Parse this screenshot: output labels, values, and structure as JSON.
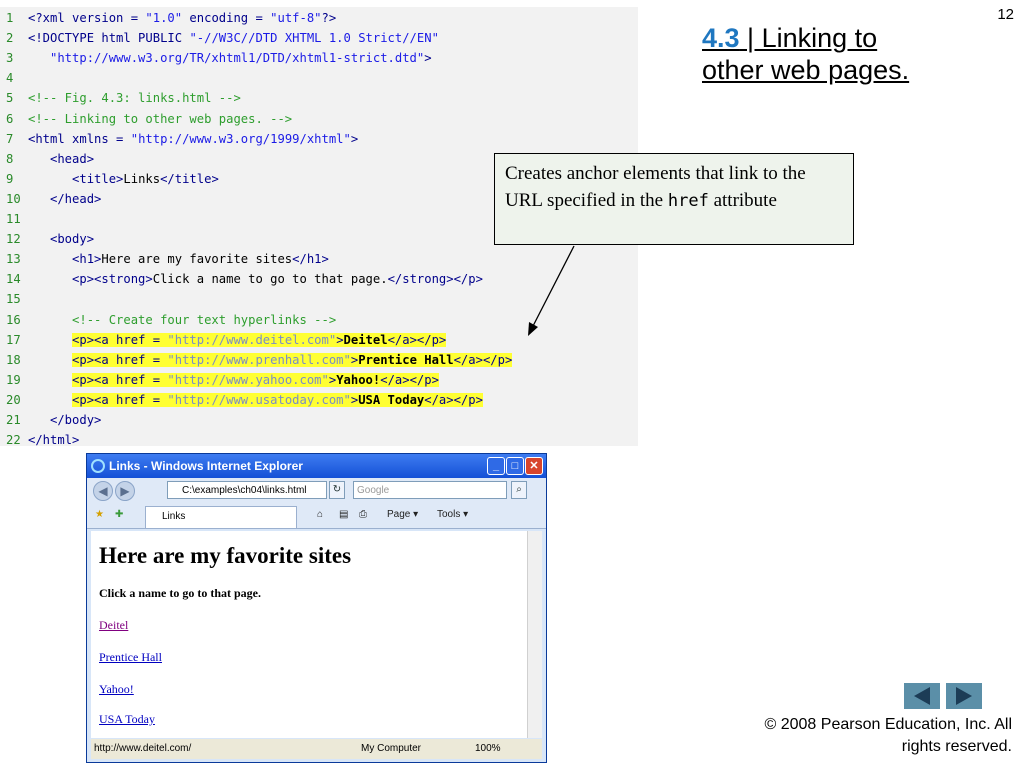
{
  "slide": {
    "number": "12",
    "title_num": "4.3",
    "title_rest": " | Linking to other web pages.",
    "callout_pre": "Creates anchor elements that link to the URL specified in the ",
    "callout_code": "href",
    "callout_post": " attribute",
    "copyright": "© 2008 Pearson Education, Inc.  All rights reserved."
  },
  "code": [
    {
      "n": "1",
      "parts": [
        [
          "tag",
          "<?xml version = "
        ],
        [
          "str",
          "\"1.0\""
        ],
        [
          "tag",
          " encoding = "
        ],
        [
          "str",
          "\"utf-8\""
        ],
        [
          "tag",
          "?>"
        ]
      ]
    },
    {
      "n": "2",
      "parts": [
        [
          "tag",
          "<!DOCTYPE html PUBLIC "
        ],
        [
          "str",
          "\"-//W3C//DTD XHTML 1.0 Strict//EN\""
        ]
      ]
    },
    {
      "n": "3",
      "parts": [
        [
          "str",
          "   \"http://www.w3.org/TR/xhtml1/DTD/xhtml1-strict.dtd\""
        ],
        [
          "tag",
          ">"
        ]
      ]
    },
    {
      "n": "4",
      "parts": []
    },
    {
      "n": "5",
      "parts": [
        [
          "com",
          "<!-- Fig. 4.3: links.html -->"
        ]
      ]
    },
    {
      "n": "6",
      "parts": [
        [
          "com",
          "<!-- Linking to other web pages. -->"
        ]
      ]
    },
    {
      "n": "7",
      "parts": [
        [
          "tag",
          "<html xmlns = "
        ],
        [
          "str",
          "\"http://www.w3.org/1999/xhtml\""
        ],
        [
          "tag",
          ">"
        ]
      ]
    },
    {
      "n": "8",
      "parts": [
        [
          "tag",
          "   <head>"
        ]
      ]
    },
    {
      "n": "9",
      "parts": [
        [
          "tag",
          "      <title>"
        ],
        [
          "txt",
          "Links"
        ],
        [
          "tag",
          "</title>"
        ]
      ]
    },
    {
      "n": "10",
      "parts": [
        [
          "tag",
          "   </head>"
        ]
      ]
    },
    {
      "n": "11",
      "parts": []
    },
    {
      "n": "12",
      "parts": [
        [
          "tag",
          "   <body>"
        ]
      ]
    },
    {
      "n": "13",
      "parts": [
        [
          "tag",
          "      <h1>"
        ],
        [
          "txt",
          "Here are my favorite sites"
        ],
        [
          "tag",
          "</h1>"
        ]
      ]
    },
    {
      "n": "14",
      "parts": [
        [
          "tag",
          "      <p><strong>"
        ],
        [
          "txt",
          "Click a name to go to that page."
        ],
        [
          "tag",
          "</strong></p>"
        ]
      ]
    },
    {
      "n": "15",
      "parts": []
    },
    {
      "n": "16",
      "parts": [
        [
          "com",
          "      <!-- Create four text hyperlinks -->"
        ]
      ]
    },
    {
      "n": "17",
      "hl": true,
      "parts": [
        [
          "tag",
          "<p><a href = "
        ],
        [
          "str",
          "\"http://www.deitel.com\""
        ],
        [
          "tag",
          ">"
        ],
        [
          "b",
          "Deitel"
        ],
        [
          "tag",
          "</a></p>"
        ]
      ]
    },
    {
      "n": "18",
      "hl": true,
      "parts": [
        [
          "tag",
          "<p><a href = "
        ],
        [
          "str",
          "\"http://www.prenhall.com\""
        ],
        [
          "tag",
          ">"
        ],
        [
          "b",
          "Prentice Hall"
        ],
        [
          "tag",
          "</a></p>"
        ]
      ]
    },
    {
      "n": "19",
      "hl": true,
      "parts": [
        [
          "tag",
          "<p><a href = "
        ],
        [
          "str",
          "\"http://www.yahoo.com\""
        ],
        [
          "tag",
          ">"
        ],
        [
          "b",
          "Yahoo!"
        ],
        [
          "tag",
          "</a></p>"
        ]
      ]
    },
    {
      "n": "20",
      "hl": true,
      "parts": [
        [
          "tag",
          "<p><a href = "
        ],
        [
          "str",
          "\"http://www.usatoday.com\""
        ],
        [
          "tag",
          ">"
        ],
        [
          "b",
          "USA Today"
        ],
        [
          "tag",
          "</a></p>"
        ]
      ]
    },
    {
      "n": "21",
      "parts": [
        [
          "tag",
          "   </body>"
        ]
      ]
    },
    {
      "n": "22",
      "parts": [
        [
          "tag",
          "</html>"
        ]
      ]
    }
  ],
  "browser": {
    "window_title": "Links - Windows Internet Explorer",
    "address": "C:\\examples\\ch04\\links.html",
    "search_placeholder": "Google",
    "tab_label": "Links",
    "toolbar_page": "Page ▾",
    "toolbar_tools": "Tools ▾",
    "heading": "Here are my favorite sites",
    "lead": "Click a name to go to that page.",
    "links": [
      "Deitel",
      "Prentice Hall",
      "Yahoo!",
      "USA Today"
    ],
    "status_url": "http://www.deitel.com/",
    "status_zone": "My Computer",
    "status_zoom": "100%"
  },
  "colors": {
    "highlight": "#ffff33",
    "title_number": "#1f77c0",
    "nav_arrow": "#5b8fa8"
  }
}
